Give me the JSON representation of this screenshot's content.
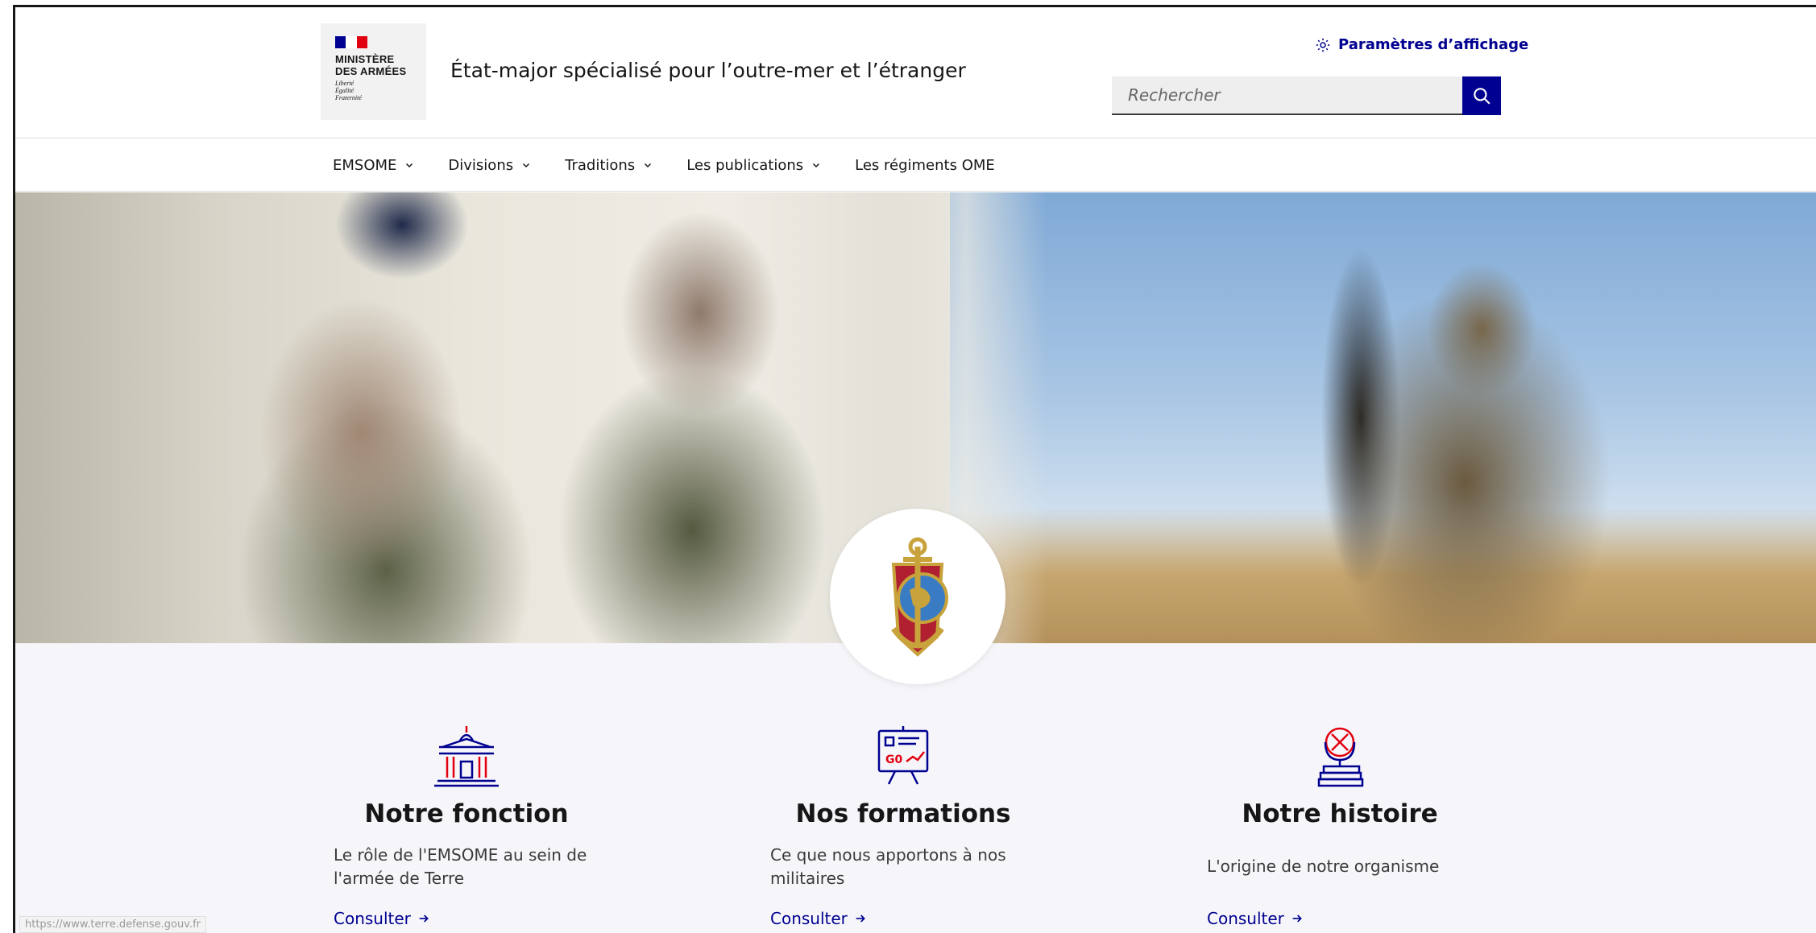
{
  "header": {
    "ministry": "MINISTÈRE\nDES ARMÉES",
    "motto": "Liberté\nÉgalité\nFraternité",
    "site_title": "État-major spécialisé pour l’outre-mer et l’étranger",
    "display_settings": "Paramètres d’affichage",
    "search_placeholder": "Rechercher"
  },
  "nav": {
    "items": [
      {
        "label": "EMSOME",
        "has_dropdown": true
      },
      {
        "label": "Divisions",
        "has_dropdown": true
      },
      {
        "label": "Traditions",
        "has_dropdown": true
      },
      {
        "label": "Les publications",
        "has_dropdown": true
      },
      {
        "label": "Les régiments OME",
        "has_dropdown": false
      }
    ]
  },
  "cards": [
    {
      "title": "Notre fonction",
      "text": "Le rôle de l'EMSOME au sein de l'armée de Terre",
      "link": "Consulter",
      "icon": "government-building-icon"
    },
    {
      "title": "Nos formations",
      "text": "Ce que nous apportons à nos militaires",
      "link": "Consulter",
      "icon": "training-board-icon"
    },
    {
      "title": "Notre histoire",
      "text": "L'origine de notre organisme",
      "link": "Consulter",
      "icon": "history-globe-icon"
    }
  ],
  "status_url": "https://www.terre.defense.gouv.fr",
  "colors": {
    "primary": "#000091",
    "accent_red": "#e1000f",
    "band_bg": "#f6f6fa"
  }
}
